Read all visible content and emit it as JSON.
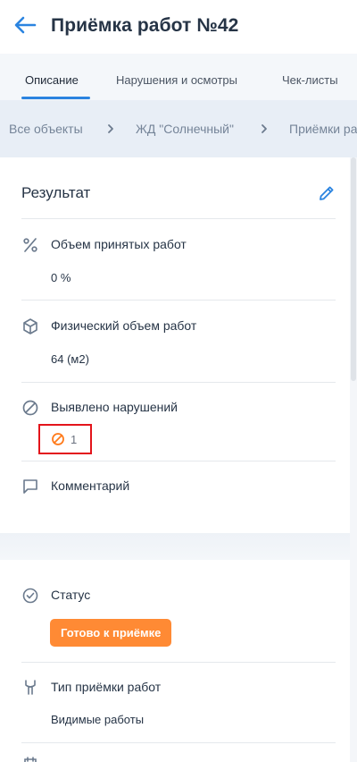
{
  "header": {
    "title": "Приёмка работ №42",
    "back_icon": "arrow-left-icon",
    "accent": "#2b84e0"
  },
  "tabs": [
    {
      "label": "Описание",
      "active": true
    },
    {
      "label": "Нарушения и осмотры",
      "active": false
    },
    {
      "label": "Чек-листы",
      "active": false
    }
  ],
  "breadcrumb": [
    "Все объекты",
    "ЖД \"Солнечный\"",
    "Приёмки ра"
  ],
  "result": {
    "title": "Результат",
    "edit_icon": "pencil-icon",
    "accepted_volume": {
      "label": "Объем принятых работ",
      "value": "0 %",
      "icon": "percent-icon"
    },
    "physical_volume": {
      "label": "Физический объем работ",
      "value": "64 (м2)",
      "icon": "cube-icon"
    },
    "violations": {
      "label": "Выявлено нарушений",
      "value": "1",
      "icon": "forbidden-icon",
      "highlight_color": "#e3141b"
    },
    "comment": {
      "label": "Комментарий",
      "icon": "comment-icon"
    }
  },
  "details": {
    "status": {
      "label": "Статус",
      "value": "Готово к приёмке",
      "color": "#ff8a34",
      "icon": "check-circle-icon"
    },
    "acceptance_type": {
      "label": "Тип приёмки работ",
      "value": "Видимые работы",
      "icon": "wrench-icon"
    }
  }
}
